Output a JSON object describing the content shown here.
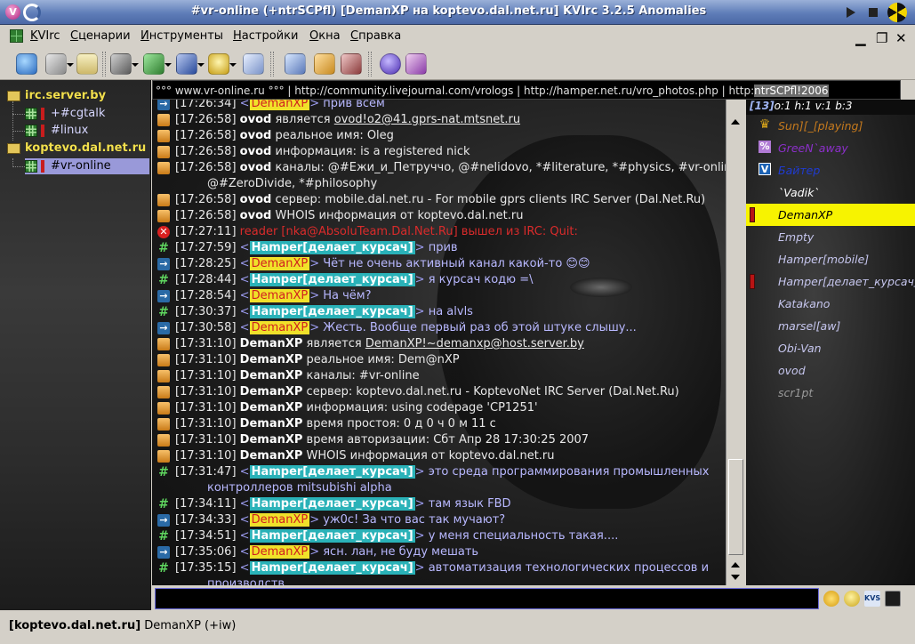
{
  "window": {
    "title": "#vr-online (+ntrSCPfl) [DemanXP на koptevo.dal.net.ru] KVIrc 3.2.5 Anomalies"
  },
  "menubar": {
    "items": [
      "KVIrc",
      "Сценарии",
      "Инструменты",
      "Настройки",
      "Окна",
      "Справка"
    ]
  },
  "toolbar": {
    "icons": [
      "connect-icon",
      "server-options-icon",
      "window-list-icon",
      "identity-icon",
      "join-channel-icon",
      "away-icon",
      "user-icon",
      "terminal-icon",
      "network-icon",
      "tools-icon",
      "scripts-icon",
      "help-icon",
      "home-icon"
    ]
  },
  "tree": {
    "servers": [
      {
        "name": "irc.server.by",
        "channels": [
          "+#cgtalk",
          "#linux"
        ]
      },
      {
        "name": "koptevo.dal.net.ru",
        "channels": [
          "#vr-online"
        ]
      }
    ]
  },
  "topic": {
    "text": "°°° www.vr-online.ru °°° | http://community.livejournal.com/vrologs | http://hamper.net.ru/vro_photos.php | http:",
    "tail": "ntrSCPfl!2006"
  },
  "chat": {
    "lines": [
      {
        "icon": "arrow",
        "time": "[17:26:34]",
        "kind": "priv",
        "nick": "DemanXP",
        "text": "прив всем"
      },
      {
        "icon": "info",
        "time": "[17:26:58]",
        "kind": "whois",
        "nick": "ovod",
        "text": "является ",
        "link": "ovod!o2@41.gprs-nat.mtsnet.ru"
      },
      {
        "icon": "info",
        "time": "[17:26:58]",
        "kind": "whois",
        "nick": "ovod",
        "text": "реальное имя: Oleg"
      },
      {
        "icon": "info",
        "time": "[17:26:58]",
        "kind": "whois",
        "nick": "ovod",
        "text": "информация: is a registered nick"
      },
      {
        "icon": "info",
        "time": "[17:26:58]",
        "kind": "whois",
        "nick": "ovod",
        "text": "каналы: @#Ежи_и_Петруччо, @#nelidovo, *#literature, *#physics, #vr-online,",
        "cont": "@#ZeroDivide, *#philosophy"
      },
      {
        "icon": "info",
        "time": "[17:26:58]",
        "kind": "whois",
        "nick": "ovod",
        "text": "сервер: mobile.dal.net.ru - For mobile gprs clients IRC Server (Dal.Net.Ru)"
      },
      {
        "icon": "info",
        "time": "[17:26:58]",
        "kind": "whois",
        "nick": "ovod",
        "text": "WHOIS информация от koptevo.dal.net.ru"
      },
      {
        "icon": "quit",
        "time": "[17:27:11]",
        "kind": "quit",
        "text": "reader [nka@AbsoluTeam.Dal.Net.Ru] вышел из IRC: Quit:"
      },
      {
        "icon": "hash",
        "time": "[17:27:59]",
        "kind": "chan",
        "nick": "Hamper[делает_курсач]",
        "text": "прив"
      },
      {
        "icon": "arrow",
        "time": "[17:28:25]",
        "kind": "priv",
        "nick": "DemanXP",
        "text": "Чёт не очень активный канал какой-то 😊😊"
      },
      {
        "icon": "hash",
        "time": "[17:28:44]",
        "kind": "chan",
        "nick": "Hamper[делает_курсач]",
        "text": "я курсач кодю =\\"
      },
      {
        "icon": "arrow",
        "time": "[17:28:54]",
        "kind": "priv",
        "nick": "DemanXP",
        "text": "На чём?"
      },
      {
        "icon": "hash",
        "time": "[17:30:37]",
        "kind": "chan",
        "nick": "Hamper[делает_курсач]",
        "text": "на alvls"
      },
      {
        "icon": "arrow",
        "time": "[17:30:58]",
        "kind": "priv",
        "nick": "DemanXP",
        "text": "Жесть. Вообще первый раз об этой штуке слышу..."
      },
      {
        "icon": "info",
        "time": "[17:31:10]",
        "kind": "whois",
        "nick": "DemanXP",
        "text": "является ",
        "link": "DemanXP!~demanxp@host.server.by"
      },
      {
        "icon": "info",
        "time": "[17:31:10]",
        "kind": "whois",
        "nick": "DemanXP",
        "text": "реальное имя: Dem@nXP"
      },
      {
        "icon": "info",
        "time": "[17:31:10]",
        "kind": "whois",
        "nick": "DemanXP",
        "text": "каналы: #vr-online"
      },
      {
        "icon": "info",
        "time": "[17:31:10]",
        "kind": "whois",
        "nick": "DemanXP",
        "text": "сервер: koptevo.dal.net.ru - KoptevoNet IRC Server (Dal.Net.Ru)"
      },
      {
        "icon": "info",
        "time": "[17:31:10]",
        "kind": "whois",
        "nick": "DemanXP",
        "text": "информация: using codepage 'CP1251'"
      },
      {
        "icon": "info",
        "time": "[17:31:10]",
        "kind": "whois",
        "nick": "DemanXP",
        "text": "время простоя: 0 д 0 ч 0 м 11 с"
      },
      {
        "icon": "info",
        "time": "[17:31:10]",
        "kind": "whois",
        "nick": "DemanXP",
        "text": "время авторизации: Сбт Апр 28 17:30:25 2007"
      },
      {
        "icon": "info",
        "time": "[17:31:10]",
        "kind": "whois",
        "nick": "DemanXP",
        "text": "WHOIS информация от koptevo.dal.net.ru"
      },
      {
        "icon": "hash",
        "time": "[17:31:47]",
        "kind": "chan",
        "nick": "Hamper[делает_курсач]",
        "text": "это среда программирования промышленных",
        "cont": "контроллеров mitsubishi alpha"
      },
      {
        "icon": "hash",
        "time": "[17:34:11]",
        "kind": "chan",
        "nick": "Hamper[делает_курсач]",
        "text": "там язык FBD"
      },
      {
        "icon": "arrow",
        "time": "[17:34:33]",
        "kind": "priv",
        "nick": "DemanXP",
        "text": "уж0с! За что вас так мучают?"
      },
      {
        "icon": "hash",
        "time": "[17:34:51]",
        "kind": "chan",
        "nick": "Hamper[делает_курсач]",
        "text": "у меня специальность такая...."
      },
      {
        "icon": "arrow",
        "time": "[17:35:06]",
        "kind": "priv",
        "nick": "DemanXP",
        "text": "ясн. лан, не буду мешать"
      },
      {
        "icon": "hash",
        "time": "[17:35:15]",
        "kind": "chan",
        "nick": "Hamper[делает_курсач]",
        "text": "автоматизация технологических процессов и",
        "cont": "производств"
      }
    ]
  },
  "userlist": {
    "header_count": "[13]",
    "header_modes": "o:1 h:1 v:1 b:3",
    "users": [
      {
        "name": "Sun][_[playing]",
        "mode": "crown",
        "bar": false,
        "sel": false,
        "color": "#c67a1d"
      },
      {
        "name": "GreeN`away",
        "mode": "pct",
        "bar": false,
        "sel": false,
        "color": "#8b2fc9"
      },
      {
        "name": "Байтер",
        "mode": "v",
        "bar": false,
        "sel": false,
        "color": "#1f3bd1"
      },
      {
        "name": "`Vadik`",
        "mode": "",
        "bar": false,
        "sel": false,
        "color": "#ffffff"
      },
      {
        "name": "DemanXP",
        "mode": "",
        "bar": true,
        "sel": true,
        "color": "#000000"
      },
      {
        "name": "Empty",
        "mode": "",
        "bar": false,
        "sel": false,
        "color": "#c6c6ee"
      },
      {
        "name": "Hamper[mobile]",
        "mode": "",
        "bar": false,
        "sel": false,
        "color": "#c6c6ee"
      },
      {
        "name": "Hamper[делает_курсач]",
        "mode": "",
        "bar": true,
        "sel": false,
        "color": "#c6c6ee"
      },
      {
        "name": "Katakano",
        "mode": "",
        "bar": false,
        "sel": false,
        "color": "#c6c6ee"
      },
      {
        "name": "marsel[aw]",
        "mode": "",
        "bar": false,
        "sel": false,
        "color": "#c6c6ee"
      },
      {
        "name": "Obi-Van",
        "mode": "",
        "bar": false,
        "sel": false,
        "color": "#c6c6ee"
      },
      {
        "name": "ovod",
        "mode": "",
        "bar": false,
        "sel": false,
        "color": "#c6c6ee"
      },
      {
        "name": "scr1pt",
        "mode": "",
        "bar": false,
        "sel": false,
        "color": "#9a9a9a"
      }
    ]
  },
  "input": {
    "value": "",
    "icons": [
      "smiley-icon",
      "emoticon-icon",
      "kvs-icon",
      "history-icon"
    ],
    "kvs_label": "KVS"
  },
  "statusbar": {
    "server": "[koptevo.dal.net.ru]",
    "user": "DemanXP (+iw)"
  }
}
